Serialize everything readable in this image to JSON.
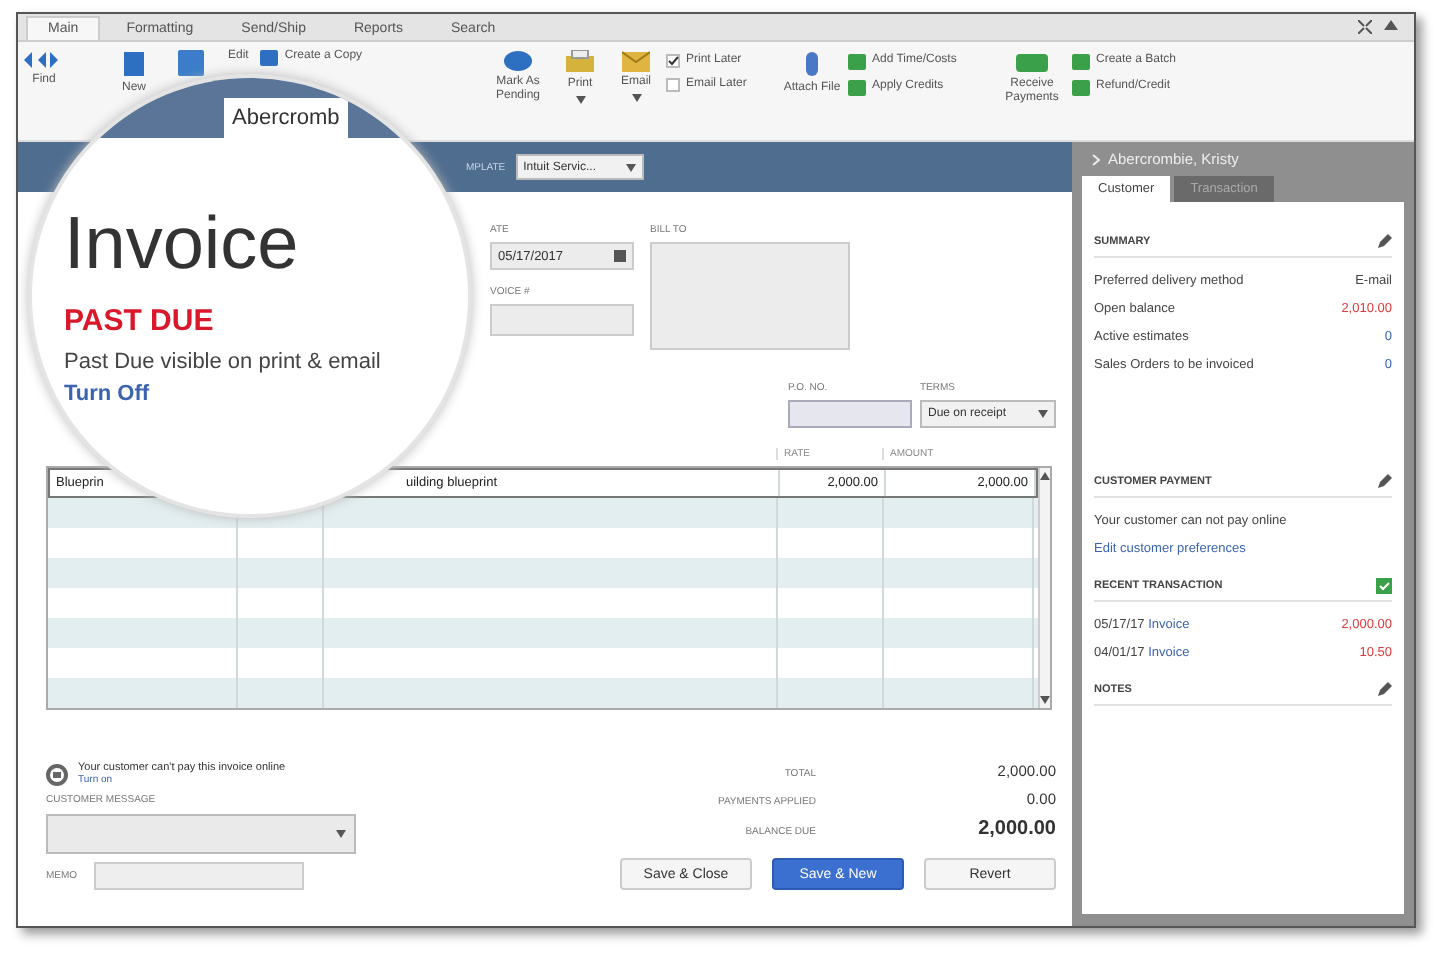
{
  "menu_tabs": [
    {
      "label": "Main",
      "selected": true
    },
    {
      "label": "Formatting",
      "selected": false
    },
    {
      "label": "Send/Ship",
      "selected": false
    },
    {
      "label": "Reports",
      "selected": false
    },
    {
      "label": "Search",
      "selected": false
    }
  ],
  "toolbar": [
    {
      "kind": "big",
      "label": "Find"
    },
    {
      "kind": "big",
      "label": "New"
    },
    {
      "kind": "icon"
    },
    {
      "kind": "inline",
      "rows": [
        "Edit",
        "Create a Copy"
      ]
    },
    {
      "kind": "big",
      "label": "Mark As Pending"
    },
    {
      "kind": "big",
      "label": "Print",
      "dropdown": true
    },
    {
      "kind": "big",
      "label": "Email",
      "dropdown": true
    },
    {
      "kind": "checks",
      "rows": [
        {
          "label": "Print Later",
          "checked": true
        },
        {
          "label": "Email Later",
          "checked": false
        }
      ]
    },
    {
      "kind": "big",
      "label": "Attach File"
    },
    {
      "kind": "pair",
      "rows": [
        "Add Time/Costs",
        "Apply Credits"
      ]
    },
    {
      "kind": "big",
      "label": "Receive Payments"
    },
    {
      "kind": "pair",
      "rows": [
        "Create a Batch",
        "Refund/Credit"
      ]
    }
  ],
  "magnifier": {
    "customer": "Abercromb",
    "title": "Invoice",
    "status": "PAST DUE",
    "note": "Past Due visible on print & email",
    "link": "Turn Off"
  },
  "form": {
    "template_label": "MPLATE",
    "template": "Intuit Servic...",
    "date_label": "ATE",
    "date": "05/17/2017",
    "invoice_label": "VOICE #",
    "bill_to_label": "BILL TO",
    "po_label": "P.O. NO.",
    "terms_label": "TERMS",
    "terms": "Due on receipt"
  },
  "table": {
    "columns": [
      "RATE",
      "AMOUNT"
    ],
    "rows": [
      {
        "item": "Blueprin",
        "description": "uilding blueprint",
        "rate": "2,000.00",
        "amount": "2,000.00"
      }
    ]
  },
  "online_notice": {
    "text": "Your customer can't pay this invoice online",
    "link": "Turn on"
  },
  "customer_message_label": "CUSTOMER MESSAGE",
  "memo_label": "MEMO",
  "totals": [
    {
      "label": "TOTAL",
      "value": "2,000.00"
    },
    {
      "label": "PAYMENTS APPLIED",
      "value": "0.00"
    },
    {
      "label": "BALANCE DUE",
      "value": "2,000.00"
    }
  ],
  "buttons": [
    {
      "label": "Save & Close",
      "primary": false
    },
    {
      "label": "Save & New",
      "primary": true
    },
    {
      "label": "Revert",
      "primary": false
    }
  ],
  "side_panel": {
    "title": "Abercrombie, Kristy",
    "tabs": [
      {
        "label": "Customer",
        "selected": true
      },
      {
        "label": "Transaction",
        "selected": false
      }
    ],
    "summary": {
      "title": "SUMMARY",
      "rows": [
        {
          "label": "Preferred delivery method",
          "value": "E-mail",
          "kind": "plain"
        },
        {
          "label": "Open balance",
          "value": "2,010.00",
          "kind": "due"
        },
        {
          "label": "Active estimates",
          "value": "0",
          "kind": "link"
        },
        {
          "label": "Sales Orders to be invoiced",
          "value": "0",
          "kind": "link"
        }
      ]
    },
    "payment": {
      "title": "CUSTOMER PAYMENT",
      "text": "Your customer can not pay online",
      "link": "Edit customer preferences"
    },
    "recent": {
      "title": "RECENT TRANSACTION",
      "rows": [
        {
          "date": "05/17/17",
          "type": "Invoice",
          "amount": "2,000.00"
        },
        {
          "date": "04/01/17",
          "type": "Invoice",
          "amount": "10.50"
        }
      ]
    },
    "notes": {
      "title": "NOTES"
    }
  }
}
